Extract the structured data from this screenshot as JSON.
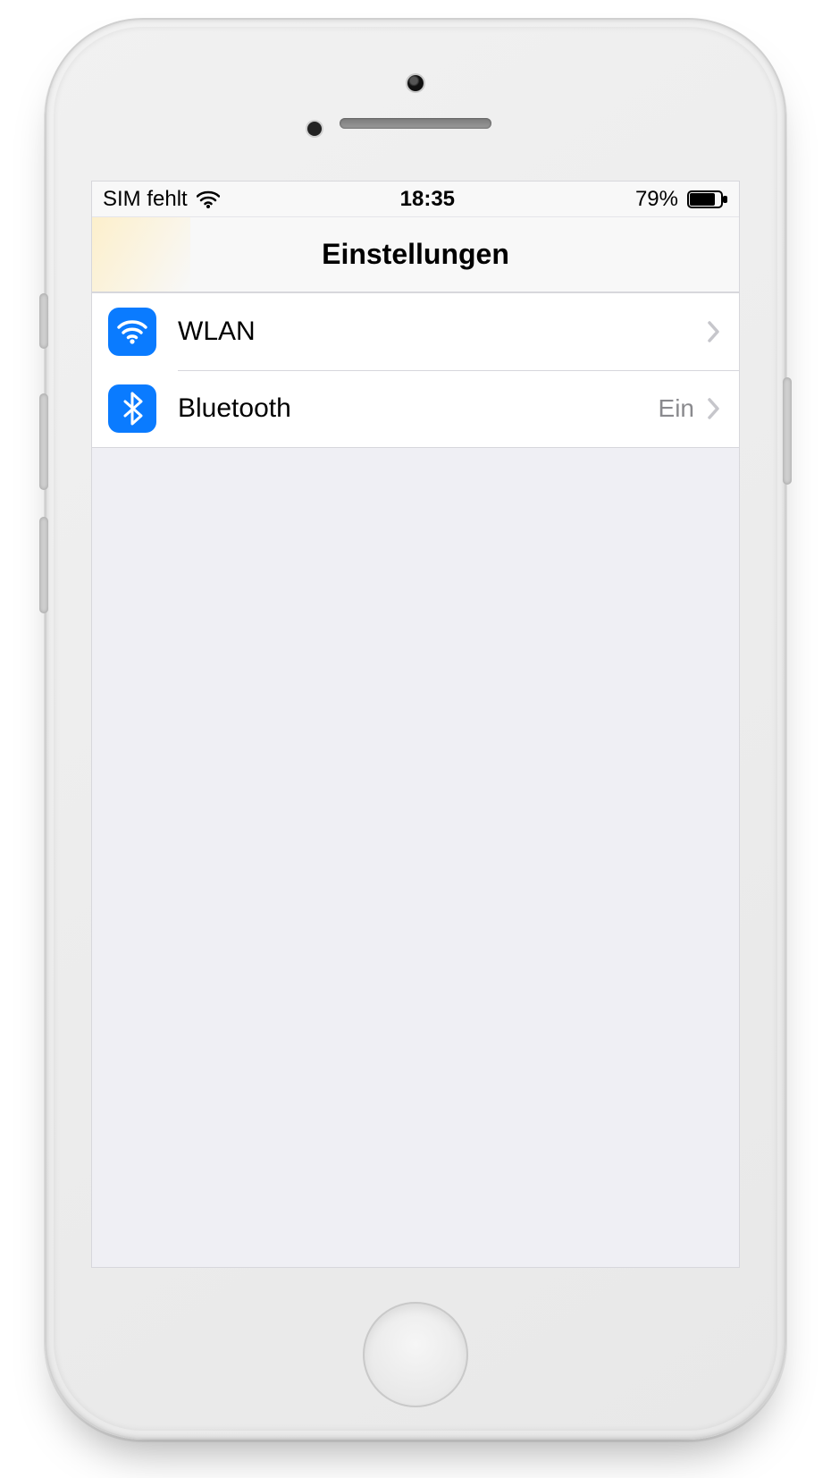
{
  "statusbar": {
    "carrier": "SIM fehlt",
    "time": "18:35",
    "battery_pct": "79%"
  },
  "navbar": {
    "title": "Einstellungen"
  },
  "rows": {
    "wlan": {
      "label": "WLAN",
      "value": ""
    },
    "bluetooth": {
      "label": "Bluetooth",
      "value": "Ein"
    }
  },
  "colors": {
    "icon_bg": "#0a7bff",
    "screen_bg": "#efeff4",
    "separator": "#d7d7dc",
    "secondary_text": "#8a8a8e"
  }
}
